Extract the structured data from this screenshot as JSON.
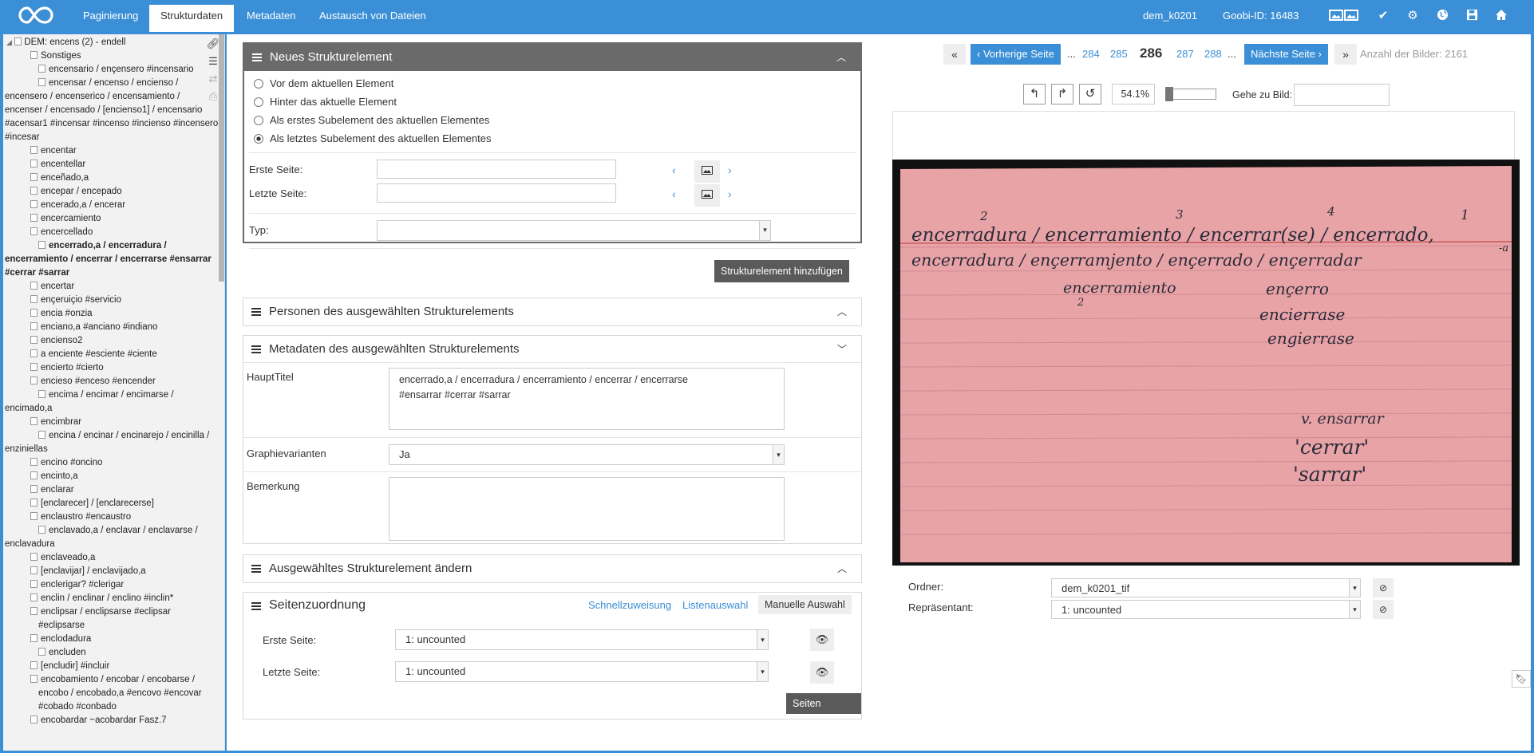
{
  "tabs": [
    "Paginierung",
    "Strukturdaten",
    "Metadaten",
    "Austausch von Dateien"
  ],
  "topbar": {
    "record": "dem_k0201",
    "goobi_id": "Goobi-ID: 16483"
  },
  "tree": {
    "root": "DEM: encens (2) - endell",
    "items": [
      "Sonstiges",
      "encensario / ençensero #incensario",
      "encensar / encenso / encienso / encensero / encenserico / encensamiento / encenser / encensado / [encienso1] / encensario #acensar1 #incensar #incenso #incienso #incensero #incesar",
      "encentar",
      "encentellar",
      "enceñado,a",
      "encepar / encepado",
      "encerado,a / encerar",
      "encercamiento",
      "encercellado",
      "encerrado,a / encerradura / encerramiento / encerrar / encerrarse #ensarrar #cerrar #sarrar",
      "encertar",
      "ençeruiçio #servicio",
      "encia #onzia",
      "enciano,a #anciano #indiano",
      "encienso2",
      "a enciente #esciente #ciente",
      "encierto #cierto",
      "encieso #enceso #encender",
      "encima / encimar / encimarse / encimado,a",
      "encimbrar",
      "encina / encinar / encinarejo / encinilla / enziniellas",
      "encino #oncino",
      "encinto,a",
      "enclarar",
      "[enclarecer] / [enclarecerse]",
      "enclaustro #encaustro",
      "enclavado,a / enclavar / enclavarse / enclavadura",
      "enclaveado,a",
      "[enclavijar] / enclavijado,a",
      "enclerigar? #clerigar",
      "enclin / enclinar / enclino #inclin*",
      "enclipsar / enclipsarse #eclipsar #eclipsarse",
      "enclodadura",
      "encluden",
      "[encludir] #incluir",
      "encobamiento / encobar / encobarse / encobo / encobado,a #encovo #encovar #cobado #conbado",
      "encobardar ~acobardar Fasz.7"
    ]
  },
  "new_element": {
    "title": "Neues Strukturelement",
    "options": [
      "Vor dem aktuellen Element",
      "Hinter das aktuelle Element",
      "Als erstes Subelement des aktuellen Elementes",
      "Als letztes Subelement des aktuellen Elementes"
    ],
    "first_page": "Erste Seite:",
    "last_page": "Letzte Seite:",
    "type": "Typ:",
    "add_button": "Strukturelement hinzufügen"
  },
  "persons": {
    "title": "Personen des ausgewählten Strukturelements"
  },
  "metadata": {
    "title": "Metadaten des ausgewählten Strukturelements",
    "haupttitel_label": "HauptTitel",
    "haupttitel_value": "encerrado,a / encerradura / encerramiento / encerrar / encerrarse\n#ensarrar #cerrar #sarrar",
    "graphie_label": "Graphievarianten",
    "graphie_value": "Ja",
    "bemerkung_label": "Bemerkung"
  },
  "change": {
    "title": "Ausgewähltes Strukturelement ändern"
  },
  "pages": {
    "title": "Seitenzuordnung",
    "schnell": "Schnellzuweisung",
    "liste": "Listenauswahl",
    "manuell": "Manuelle Auswahl",
    "erste": "Erste Seite:",
    "letzte": "Letzte Seite:",
    "erste_value": "1: uncounted",
    "letzte_value": "1: uncounted",
    "assign": "Seiten zuweisen"
  },
  "pager": {
    "prev": "Vorherige Seite",
    "next": "Nächste Seite",
    "dots": "...",
    "pages": [
      "284",
      "285",
      "286",
      "287",
      "288"
    ],
    "current": "286",
    "count": "Anzahl der Bilder: 2161"
  },
  "zoom": {
    "value": "54.1%",
    "goto": "Gehe zu Bild:"
  },
  "folder": {
    "label": "Ordner:",
    "value": "dem_k0201_tif",
    "rep_label": "Repräsentant:",
    "rep_value": "1: uncounted"
  },
  "card": {
    "nums": [
      "2",
      "3",
      "4",
      "1"
    ],
    "line1": "encerradura / encerramiento / encerrar(se) / encerrado,",
    "line1b": "-a",
    "line2": "encerradura / ençerramjento / ençerrado / ençerradar",
    "l3a": "encerramiento",
    "l3b": "ençerro",
    "l3n": "2",
    "l4": "encierrase",
    "l5": "engierrase",
    "v1": "v. ensarrar",
    "v2": "'cerrar'",
    "v3": "'sarrar'"
  },
  "colors": {
    "accent": "#3b8fd6",
    "dark_panel": "#6a6a6a",
    "card": "#e8a3a6"
  },
  "icons": [
    "infinity-logo",
    "image-icon",
    "check-icon",
    "gear-icon",
    "globe-icon",
    "save-icon",
    "home-icon",
    "link-icon",
    "list-icon",
    "swap-icon",
    "print-icon",
    "rotate-left-icon",
    "rotate-right-icon",
    "reset-icon",
    "eye-icon",
    "check-circle-icon",
    "bookmark-icon"
  ]
}
